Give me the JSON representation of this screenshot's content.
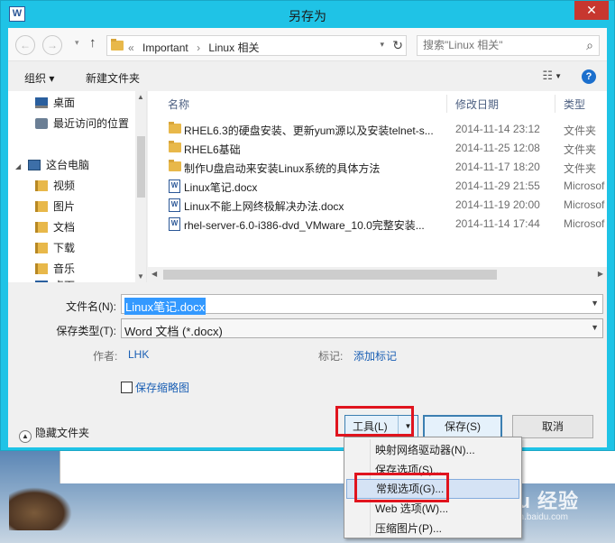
{
  "window": {
    "title": "另存为",
    "close_glyph": "✕",
    "app_icon_text": "W"
  },
  "nav": {
    "back_glyph": "←",
    "forward_glyph": "→",
    "recent_glyph": "▾",
    "up_glyph": "↑"
  },
  "address": {
    "prefix": "«",
    "crumbs": [
      "Important",
      "Linux 相关"
    ],
    "separator": "›",
    "drop_glyph": "▾",
    "refresh_glyph": "↻"
  },
  "search": {
    "placeholder": "搜索\"Linux 相关\""
  },
  "toolbar": {
    "organize": "组织 ▾",
    "new_folder": "新建文件夹",
    "view_glyph": "☷",
    "help_glyph": "?"
  },
  "navpane": {
    "items": [
      {
        "label": "桌面",
        "icon": "desktop-icon"
      },
      {
        "label": "最近访问的位置",
        "icon": "recent-places-icon"
      },
      {
        "label": "这台电脑",
        "icon": "computer-icon"
      },
      {
        "label": "视频",
        "icon": "videos-library-icon"
      },
      {
        "label": "图片",
        "icon": "pictures-library-icon"
      },
      {
        "label": "文档",
        "icon": "documents-library-icon"
      },
      {
        "label": "下载",
        "icon": "downloads-icon"
      },
      {
        "label": "音乐",
        "icon": "music-library-icon"
      },
      {
        "label": "桌面",
        "icon": "desktop-icon"
      }
    ]
  },
  "filelist": {
    "columns": {
      "name": "名称",
      "date": "修改日期",
      "type": "类型"
    },
    "rows": [
      {
        "name": "RHEL6.3的硬盘安装、更新yum源以及安装telnet-s...",
        "date": "2014-11-14 23:12",
        "type": "文件夹",
        "kind": "folder"
      },
      {
        "name": "RHEL6基础",
        "date": "2014-11-25 12:08",
        "type": "文件夹",
        "kind": "folder"
      },
      {
        "name": "制作U盘启动来安装Linux系统的具体方法",
        "date": "2014-11-17 18:20",
        "type": "文件夹",
        "kind": "folder"
      },
      {
        "name": "Linux笔记.docx",
        "date": "2014-11-29 21:55",
        "type": "Microsof",
        "kind": "doc"
      },
      {
        "name": "Linux不能上网终极解决办法.docx",
        "date": "2014-11-19 20:00",
        "type": "Microsof",
        "kind": "doc"
      },
      {
        "name": "rhel-server-6.0-i386-dvd_VMware_10.0完整安装...",
        "date": "2014-11-14 17:44",
        "type": "Microsof",
        "kind": "doc"
      }
    ]
  },
  "form": {
    "filename_label": "文件名(N):",
    "filename_value": "Linux笔记.docx",
    "savetype_label": "保存类型(T):",
    "savetype_value": "Word 文档 (*.docx)",
    "author_label": "作者:",
    "author_value": "LHK",
    "tags_label": "标记:",
    "tags_value": "添加标记",
    "thumbnail_label": "保存缩略图",
    "hide_folders": "隐藏文件夹"
  },
  "buttons": {
    "tools": "工具(L)",
    "save": "保存(S)",
    "cancel": "取消"
  },
  "tools_menu": {
    "items": [
      "映射网络驱动器(N)...",
      "保存选项(S)...",
      "常规选项(G)...",
      "Web 选项(W)...",
      "压缩图片(P)..."
    ],
    "highlighted_index": 2
  },
  "watermark": {
    "main": "Baidu 经验",
    "sub": "jingyan.baidu.com"
  },
  "colors": {
    "titlebar": "#1fc3e6",
    "highlight_box": "#e0141e",
    "link": "#1a5fb4"
  }
}
